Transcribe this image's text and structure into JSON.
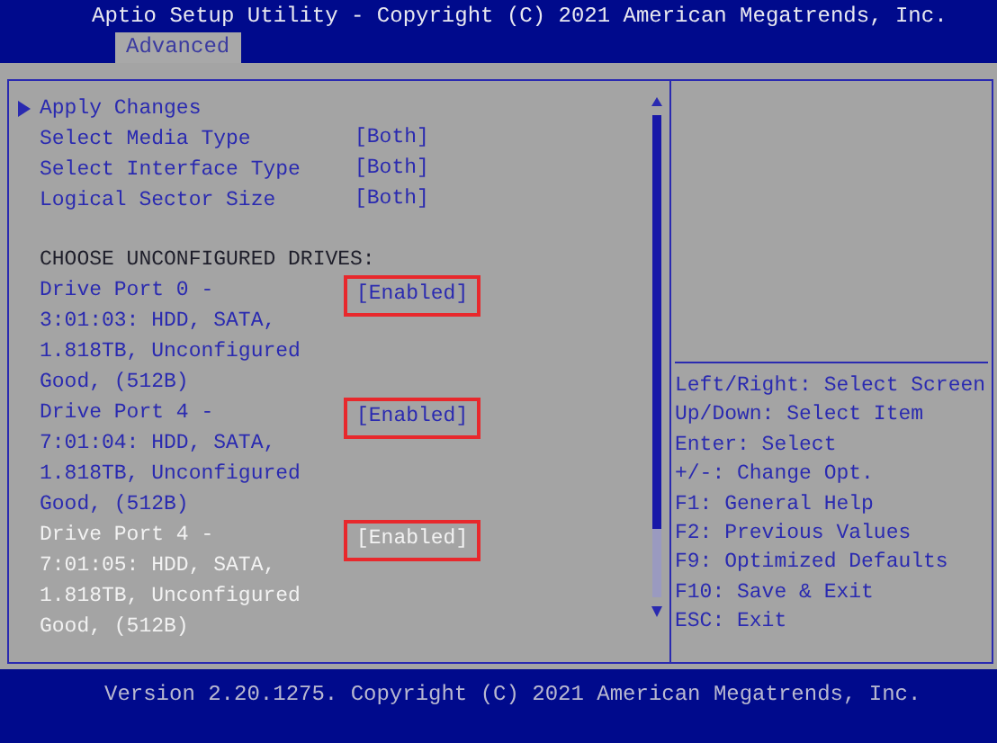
{
  "header": {
    "title": "Aptio Setup Utility - Copyright (C) 2021 American Megatrends, Inc.",
    "tabs": [
      {
        "label": "Advanced",
        "selected": true
      }
    ]
  },
  "items": [
    {
      "kind": "submenu",
      "label": "Apply Changes",
      "selected": false
    },
    {
      "kind": "setting",
      "label": "Select Media Type",
      "value": "[Both]",
      "selected": false
    },
    {
      "kind": "setting",
      "label": "Select Interface Type",
      "value": "[Both]",
      "selected": false
    },
    {
      "kind": "setting",
      "label": "Logical Sector Size",
      "value": "[Both]",
      "selected": false
    },
    {
      "kind": "heading",
      "label": "CHOOSE UNCONFIGURED DRIVES:"
    },
    {
      "kind": "drive",
      "lines": [
        "Drive Port 0 -",
        "3:01:03: HDD, SATA,",
        "1.818TB, Unconfigured",
        "Good, (512B)"
      ],
      "value": "[Enabled]",
      "selected": false,
      "outlined": true
    },
    {
      "kind": "drive",
      "lines": [
        "Drive Port 4 -",
        "7:01:04: HDD, SATA,",
        "1.818TB, Unconfigured",
        "Good, (512B)"
      ],
      "value": "[Enabled]",
      "selected": false,
      "outlined": true
    },
    {
      "kind": "drive",
      "lines": [
        "Drive Port 4 -",
        "7:01:05: HDD, SATA,",
        "1.818TB, Unconfigured",
        "Good, (512B)"
      ],
      "value": "[Enabled]",
      "selected": true,
      "outlined": true
    }
  ],
  "help": [
    "Left/Right: Select Screen",
    "Up/Down: Select Item",
    "Enter: Select",
    "+/-: Change Opt.",
    "F1: General Help",
    "F2: Previous Values",
    "F9: Optimized Defaults",
    "F10: Save & Exit",
    "ESC: Exit"
  ],
  "footer": "Version 2.20.1275. Copyright (C) 2021 American Megatrends, Inc."
}
